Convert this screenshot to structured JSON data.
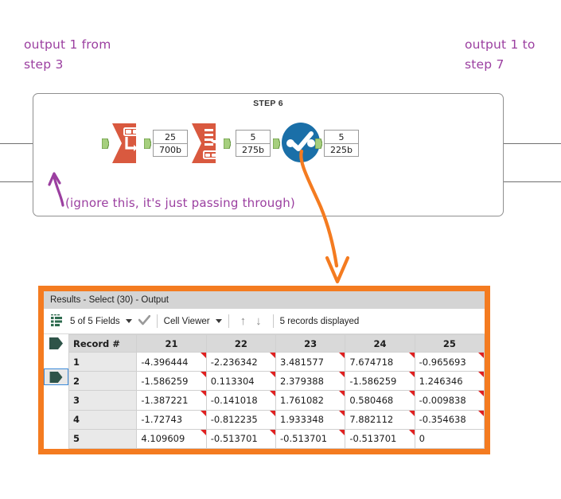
{
  "annotations": {
    "output_from": "output 1 from\nstep 3",
    "output_to": "output 1 to\nstep 7",
    "ignore_note": "(ignore this, it's just passing through)",
    "purple_color": "#9b3fa0",
    "orange_color": "#f47b20"
  },
  "workflow": {
    "step_title": "STEP 6",
    "tools": [
      {
        "name": "cross-tab-tool",
        "color": "#d9593f"
      },
      {
        "name": "transpose-tool",
        "color": "#d9593f"
      },
      {
        "name": "select-tool",
        "color": "#1a6fa8"
      }
    ],
    "badges": [
      {
        "records": "25",
        "size": "700b"
      },
      {
        "records": "5",
        "size": "275b"
      },
      {
        "records": "5",
        "size": "225b"
      }
    ]
  },
  "results": {
    "title": "Results - Select (30) - Output",
    "toolbar": {
      "fields_label": "5 of 5 Fields",
      "viewer_label": "Cell Viewer",
      "sort_up": "↑",
      "sort_down": "↓",
      "records_label": "5 records displayed"
    },
    "columns": [
      "Record #",
      "21",
      "22",
      "23",
      "24",
      "25"
    ],
    "rows": [
      {
        "record": "1",
        "values": [
          "-4.396444",
          "-2.236342",
          "3.481577",
          "7.674718",
          "-0.965693"
        ]
      },
      {
        "record": "2",
        "values": [
          "-1.586259",
          "0.113304",
          "2.379388",
          "-1.586259",
          "1.246346"
        ]
      },
      {
        "record": "3",
        "values": [
          "-1.387221",
          "-0.141018",
          "1.761082",
          "0.580468",
          "-0.009838"
        ]
      },
      {
        "record": "4",
        "values": [
          "-1.72743",
          "-0.812235",
          "1.933348",
          "7.882112",
          "-0.354638"
        ]
      },
      {
        "record": "5",
        "values": [
          "4.109609",
          "-0.513701",
          "-0.513701",
          "-0.513701",
          "0"
        ]
      }
    ]
  }
}
